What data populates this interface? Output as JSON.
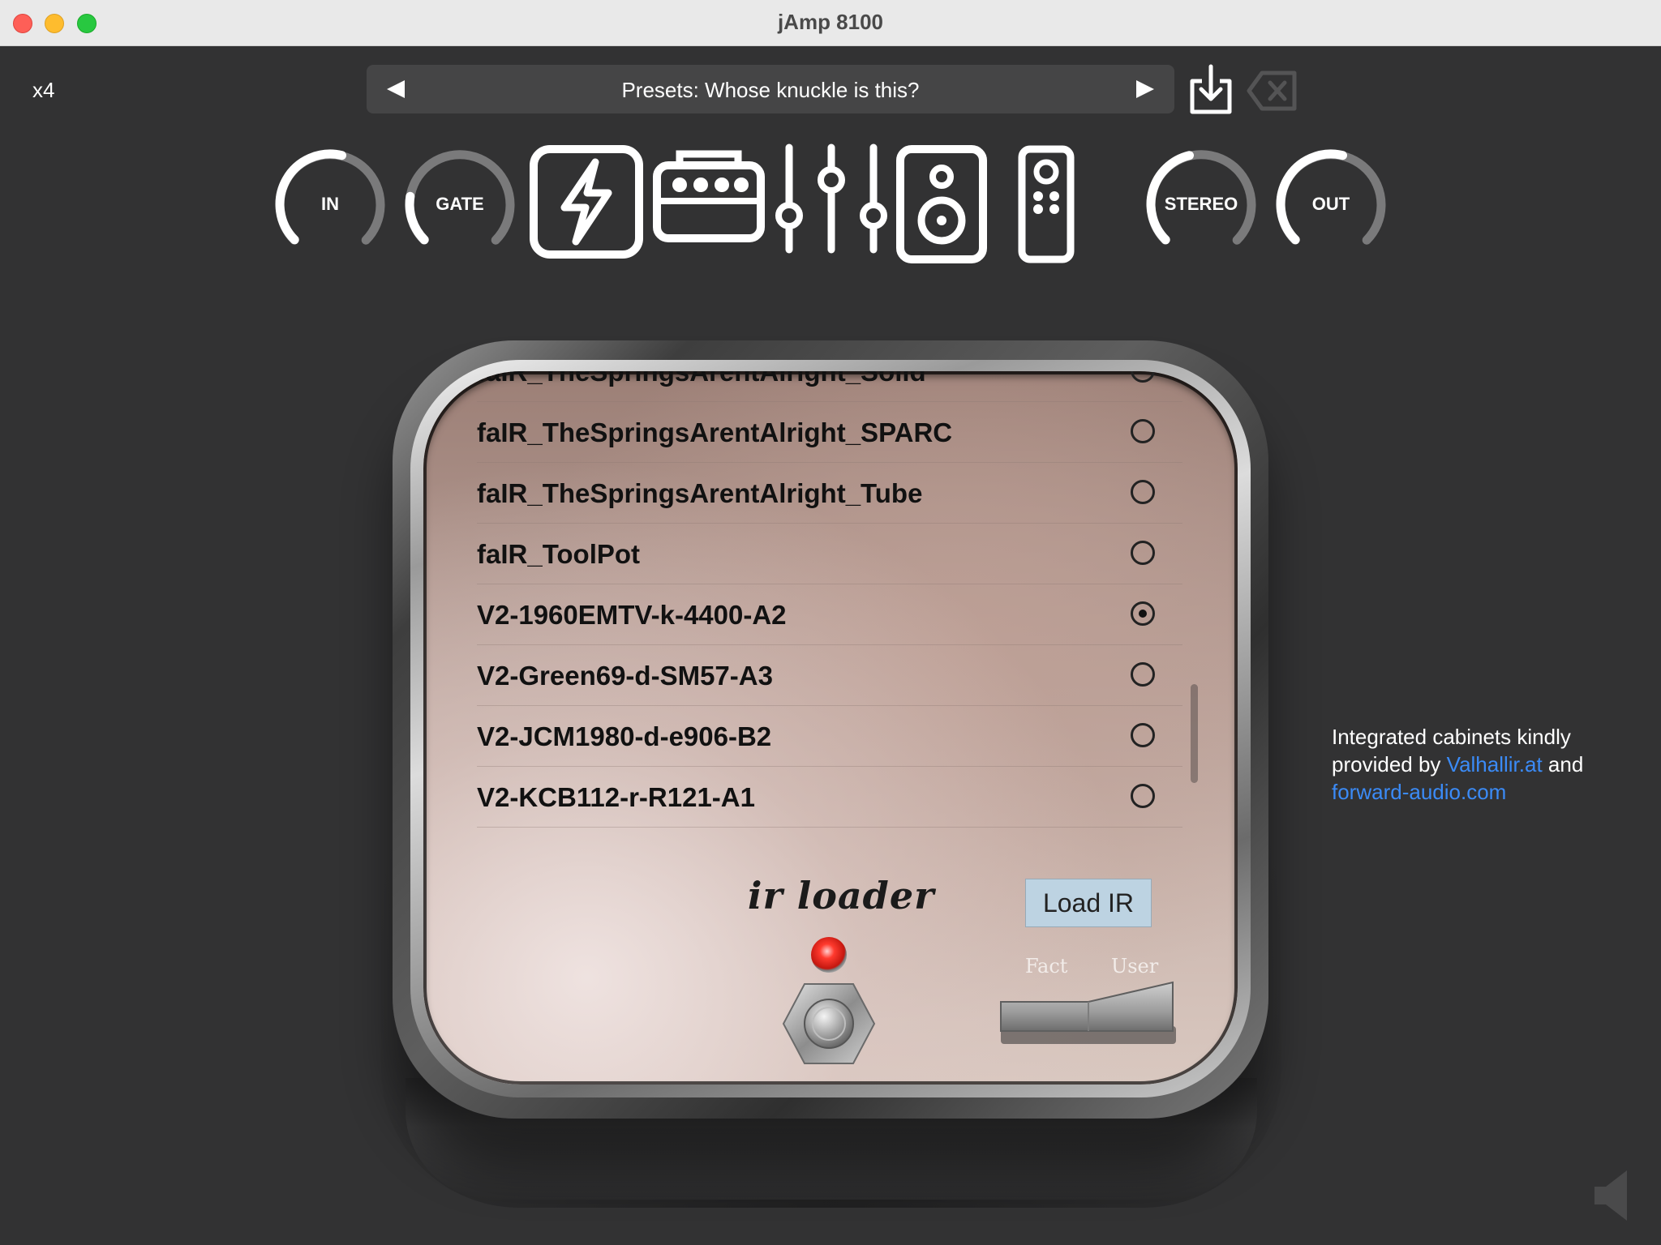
{
  "window": {
    "title": "jAmp 8100"
  },
  "toolbar": {
    "oversample": "x4",
    "preset_label": "Presets: Whose knuckle is this?"
  },
  "knobs": [
    {
      "label": "IN",
      "level": 0.55
    },
    {
      "label": "GATE",
      "level": 0.2
    },
    {
      "label": "STEREO",
      "level": 0.45
    },
    {
      "label": "OUT",
      "level": 0.55
    }
  ],
  "modules": [
    "power-icon",
    "amp-icon",
    "mixer-sliders-icon",
    "speaker-cabinet-icon",
    "remote-icon"
  ],
  "ir_list": {
    "items": [
      {
        "name": "faIR_TheSpringsArentAlright_Solid",
        "selected": false
      },
      {
        "name": "faIR_TheSpringsArentAlright_SPARC",
        "selected": false
      },
      {
        "name": "faIR_TheSpringsArentAlright_Tube",
        "selected": false
      },
      {
        "name": "faIR_ToolPot",
        "selected": false
      },
      {
        "name": "V2-1960EMTV-k-4400-A2",
        "selected": true
      },
      {
        "name": "V2-Green69-d-SM57-A3",
        "selected": false
      },
      {
        "name": "V2-JCM1980-d-e906-B2",
        "selected": false
      },
      {
        "name": "V2-KCB112-r-R121-A1",
        "selected": false
      }
    ]
  },
  "device": {
    "logo": "ir loader",
    "load_button": "Load IR",
    "toggle_left": "Fact",
    "toggle_right": "User",
    "toggle_position": "User",
    "led_on": true
  },
  "credits": {
    "line1": "Integrated cabinets kindly provided by",
    "link1": "Valhallir.at",
    "and": "and",
    "link2": "forward-audio.com"
  },
  "colors": {
    "background": "#323233",
    "link": "#3b8bf7",
    "load_button": "#bdd3e2",
    "led": "#ff3a2e"
  }
}
